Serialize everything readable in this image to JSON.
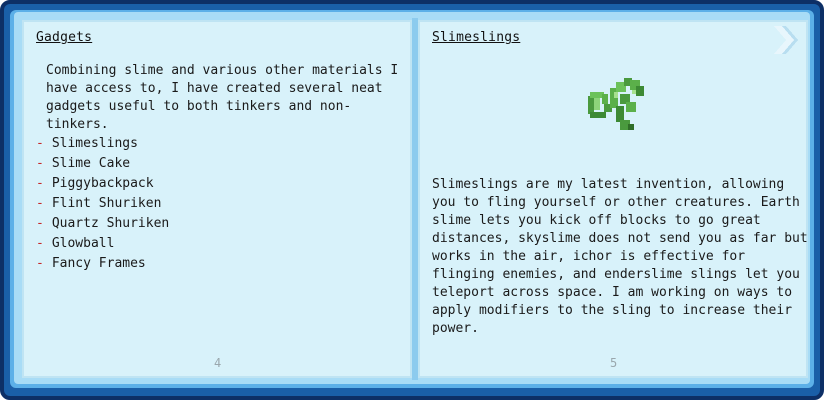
{
  "left_page": {
    "title": "Gadgets",
    "intro": "Combining slime and various other materials I have access to, I have created several neat gadgets useful to both tinkers and non-tinkers.",
    "items": [
      {
        "dash": "-",
        "label": "Slimeslings"
      },
      {
        "dash": "-",
        "label": "Slime Cake"
      },
      {
        "dash": "-",
        "label": "Piggybackpack"
      },
      {
        "dash": "-",
        "label": "Flint Shuriken"
      },
      {
        "dash": "-",
        "label": "Quartz Shuriken"
      },
      {
        "dash": "-",
        "label": "Glowball"
      },
      {
        "dash": "-",
        "label": "Fancy Frames"
      }
    ],
    "page_number": "4"
  },
  "right_page": {
    "title": "Slimeslings",
    "icon": "slimesling-icon",
    "body": "Slimeslings are my latest invention, allowing you to fling yourself or other creatures. Earth slime lets you kick off blocks to go great distances, skyslime does not send you as far but works in the air, ichor is effective for flinging enemies, and enderslime slings let you teleport across space. I am working on ways to apply modifiers to the sling to increase their power.",
    "page_number": "5"
  },
  "colors": {
    "page_background": "#d8f2fa",
    "cover": "#1a5fa8",
    "accent_dash": "#c62828",
    "slime_green": "#5bb04a"
  }
}
